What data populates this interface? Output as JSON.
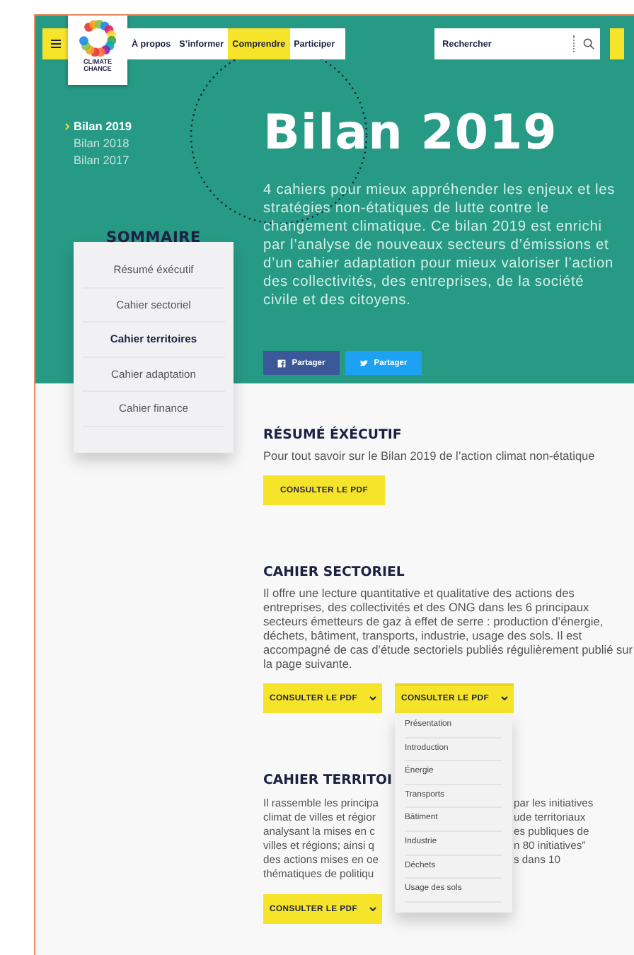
{
  "logo": {
    "lines": [
      "CLIMATE",
      "CHANCE"
    ]
  },
  "nav": [
    {
      "label": "À propos",
      "selected": false
    },
    {
      "label": "S’informer",
      "selected": false
    },
    {
      "label": "Comprendre",
      "selected": true
    },
    {
      "label": "Participer",
      "selected": false
    }
  ],
  "search": {
    "placeholder": "Rechercher"
  },
  "years": [
    {
      "label": "Bilan 2019",
      "selected": true
    },
    {
      "label": "Bilan 2018",
      "selected": false
    },
    {
      "label": "Bilan 2017",
      "selected": false
    }
  ],
  "summary": {
    "title": "SOMMAIRE",
    "items": [
      {
        "label": "Résumé éxécutif",
        "selected": false
      },
      {
        "label": "Cahier sectoriel",
        "selected": false
      },
      {
        "label": "Cahier territoires",
        "selected": true
      },
      {
        "label": "Cahier adaptation",
        "selected": false
      },
      {
        "label": "Cahier finance",
        "selected": false
      }
    ]
  },
  "hero": {
    "title": "Bilan 2019",
    "text": "4 cahiers pour mieux appréhender les enjeux et les stratégies non-étatiques de lutte contre le changement climatique. Ce bilan 2019 est enrichi par l’analyse de nouveaux secteurs d’émissions et d’un cahier adaptation pour mieux valoriser l’action des collectivités, des entreprises, de la société civile et des citoyens.",
    "share": [
      {
        "label": "Partager",
        "kind": "facebook"
      },
      {
        "label": "Partager",
        "kind": "twitter"
      }
    ]
  },
  "sections": [
    {
      "heading": "RÉSUMÉ ÉXÉCUTIF",
      "kind": "text",
      "text": "Pour tout savoir sur le Bilan 2019 de l’action climat non-étatique",
      "buttons": [
        {
          "label": "CONSULTER LE PDF",
          "kind": "plain"
        }
      ]
    },
    {
      "heading": "CAHIER SECTORIEL",
      "kind": "text",
      "text": "Il offre une lecture quantitative et qualitative des actions des entreprises, des collectivités et des ONG dans les 6 principaux secteurs émetteurs de gaz à effet de serre : production d’énergie, déchets, bâtiment, transports, industrie, usage des sols. Il est accompagné de cas d’étude sectoriels publiés régulièrement publié sur la page suivante.",
      "buttons": [
        {
          "label": "CONSULTER LE PDF",
          "kind": "dropdown"
        },
        {
          "label": "CONSULTER LE PDF",
          "kind": "dropdown",
          "expanded": true,
          "menu": [
            "Présentation",
            "Introduction",
            "Énergie",
            "Transports",
            "Bâtiment",
            "Industrie",
            "Déchets",
            "Usage des sols"
          ]
        }
      ]
    },
    {
      "heading": "CAHIER TERRITOI",
      "kind": "split",
      "lines": [
        {
          "left": "Il rassemble les principa",
          "right": "par les initiatives"
        },
        {
          "left": "climat de villes et régior",
          "right": "ude territoriaux"
        },
        {
          "left": "analysant la mises en c",
          "right": "es publiques de"
        },
        {
          "left": "villes et régions; ainsi q",
          "right": "n 80 initiatives”"
        },
        {
          "left": "des actions mises en oe",
          "right": "s dans 10"
        },
        {
          "left": "thématiques de politiqu"
        }
      ],
      "buttons": [
        {
          "label": "CONSULTER LE PDF",
          "kind": "dropdown"
        }
      ]
    }
  ]
}
